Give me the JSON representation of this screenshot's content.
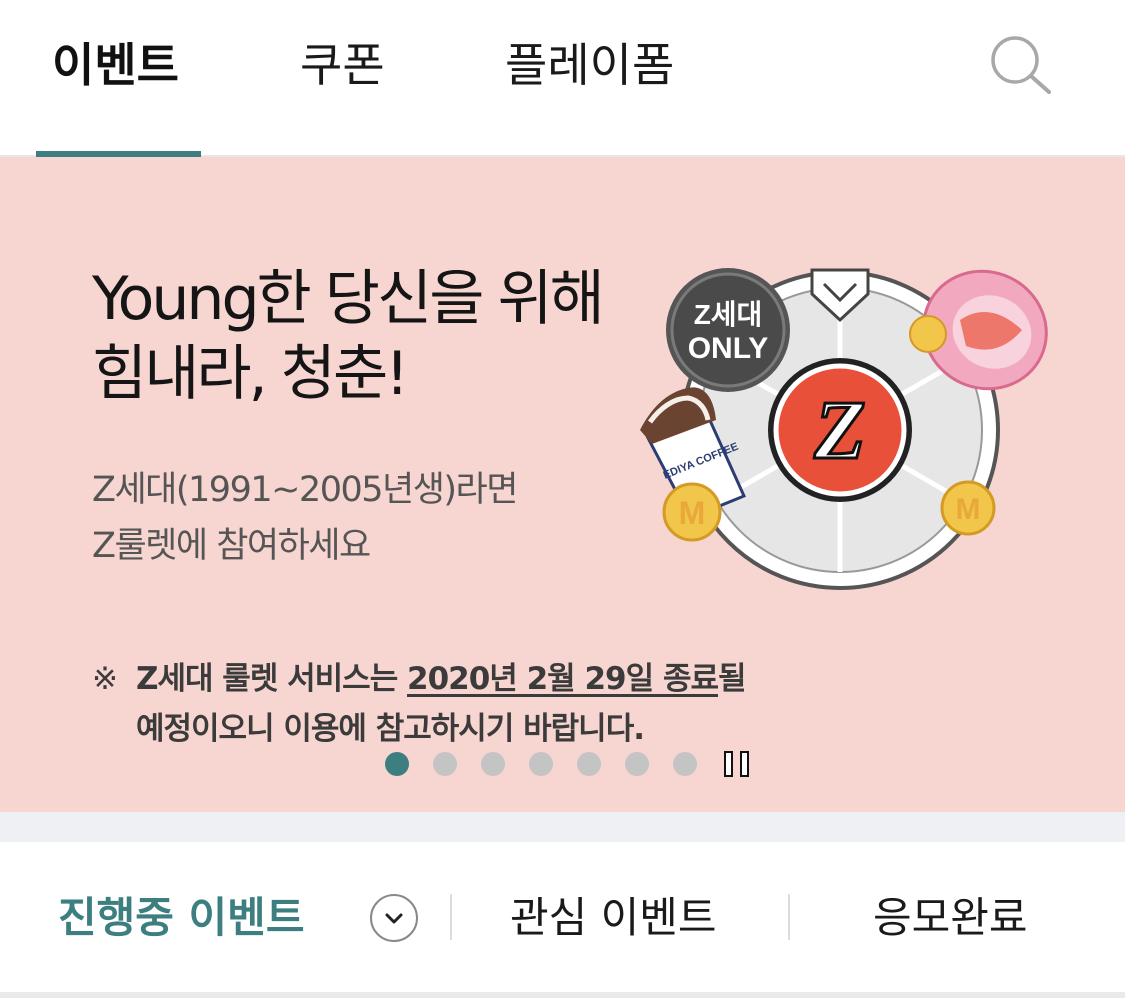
{
  "top_tabs": [
    {
      "label": "이벤트",
      "active": true
    },
    {
      "label": "쿠폰",
      "active": false
    },
    {
      "label": "플레이폼",
      "active": false
    }
  ],
  "icons": {
    "search": "search-icon",
    "dropdown": "chevron-down-icon",
    "pause": "pause-icon"
  },
  "banner": {
    "headline_line1": "Young한 당신을 위해",
    "headline_line2": "힘내라, 청춘!",
    "sub_line1": "Z세대(1991~2005년생)라면",
    "sub_line2": "Z룰렛에 참여하세요",
    "notice_mark": "※",
    "notice_line1_prefix": "Z세대 룰렛 서비스는 ",
    "notice_line1_underlined": "2020년 2월 29일 종료",
    "notice_line1_suffix": "될",
    "notice_line2": "예정이오니 이용에 참고하시기 바랍니다.",
    "badge_line1": "Z세대",
    "badge_line2": "ONLY",
    "center_letter": "Z",
    "cup_label": "EDIYA COFFEE",
    "coin_letter": "M",
    "slide_count": 7,
    "active_slide": 1
  },
  "filter_tabs": [
    {
      "label": "진행중 이벤트",
      "active": true
    },
    {
      "label": "관심 이벤트",
      "active": false
    },
    {
      "label": "응모완료",
      "active": false
    }
  ],
  "colors": {
    "accent": "#3d7f80",
    "banner_bg": "#f7d6d1",
    "dot_inactive": "#c4c4c4",
    "roulette_center": "#e8503a",
    "badge": "#4a4a4a",
    "coin": "#f2c54b"
  }
}
